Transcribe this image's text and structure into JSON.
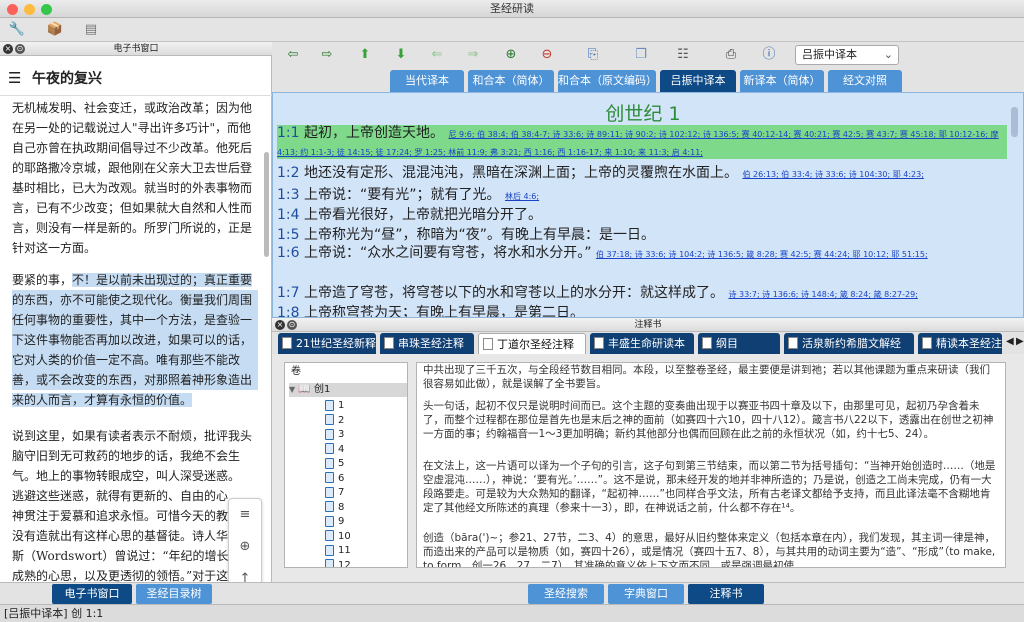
{
  "window": {
    "title": "圣经研读"
  },
  "left_panel": {
    "header": "电子书窗口",
    "article_title": "午夜的复兴",
    "paragraphs": [
      "无机械发明、社会变迁，或政治改革；因为他",
      "在另一处的记载说过人\"寻出许多巧计\"，而他",
      "自己亦曾在执政期间倡导过不少改革。他死后",
      "的耶路撒冷京城，跟他刚在父亲大卫去世后登",
      "基时相比，已大为改观。就当时的外表事物而",
      "言，已有不少改变；但如果就大自然和人性而",
      "言，则没有一样是新的。所罗门所说的，正是",
      "针对这一方面。"
    ],
    "p2_plain": "要紧的事，",
    "p2_hl": [
      "不！是以前未出现过的；真正重要",
      "的东西，亦不可能使之现代化。衡量我们周围",
      "任何事物的重要性，其中一个方法，是查验一",
      "下这件事物能否再加以改进，如果可以的话，",
      "它对人类的价值一定不高。唯有那些不能改",
      "善，或不会改变的东西，对那照着神形象造出",
      "来的人而言，才算有永恒的价值。"
    ],
    "p3": [
      "说到这里，如果有读者表示不耐烦，批评我头",
      "脑守旧到无可救药的地步的话，我绝不会生",
      "气。地上的事物转眼成空，叫人深受迷惑。",
      "逃避这些迷惑，就得有更新的、自由的心",
      "神贯注于爱慕和追求永恒。可惜今天的教",
      "没有造就出有这样心思的基督徒。诗人华",
      "斯（Wordswort）曾说过：“年纪的增长会",
      "成熟的心思，以及更透彻的领悟。”对于这句"
    ]
  },
  "left_tabs": [
    "电子书窗口",
    "圣经目录树"
  ],
  "status": "[吕振中译本] 创 1:1",
  "version_select": "吕振中译本",
  "version_tabs": [
    "当代译本",
    "和合本（简体）",
    "和合本（原文编码）",
    "吕振中译本",
    "新译本（简体）",
    "经文对照"
  ],
  "active_version_tab": 3,
  "chapter": "创世纪 1",
  "verses": [
    {
      "num": "1:1",
      "text": "起初，上帝创造天地。",
      "refs": "尼 9:6; 伯 38:4; 伯 38:4-7; 诗 33:6; 诗 89:11; 诗 90:2; 诗 102:12; 诗 136:5; 赛 40:12-14; 赛 40:21; 赛 42:5; 赛 43:7; 赛 45:18; 耶 10:12-16; 摩 4:13; 约 1:1-3; 徒 14:15; 徒 17:24; 罗 1:25; 林前 11:9; 弗 3:21; 西 1:16; 西 1:16-17; 来 1:10; 来 11:3; 启 4:11;"
    },
    {
      "num": "1:2",
      "text": "地还没有定形、混混沌沌，黑暗在深渊上面；上帝的灵覆煦在水面上。",
      "refs": "伯 26:13; 伯 33:4; 诗 33:6; 诗 104:30; 耶 4:23;"
    },
    {
      "num": "1:3",
      "text": "上帝说：“要有光”；就有了光。",
      "refs": "林后 4:6;"
    },
    {
      "num": "1:4",
      "text": "上帝看光很好，上帝就把光暗分开了。",
      "refs": ""
    },
    {
      "num": "1:5",
      "text": "上帝称光为“昼”，称暗为“夜”。有晚上有早晨：是一日。",
      "refs": ""
    },
    {
      "num": "1:6",
      "text": "上帝说：“众水之间要有穹苍，将水和水分开。”",
      "refs": "伯 37:18; 诗 33:6; 诗 104:2; 诗 136:5; 箴 8:28; 赛 42:5; 赛 44:24; 耶 10:12; 耶 51:15;"
    },
    {
      "num": "1:7",
      "text": "上帝造了穹苍，将穹苍以下的水和穹苍以上的水分开：就这样成了。",
      "refs": "诗 33:7; 诗 136:6; 诗 148:4; 箴 8:24; 箴 8:27-29;"
    },
    {
      "num": "1:8",
      "text": "上帝称穹苍为天；有晚上有早晨，是第二日。",
      "refs": ""
    }
  ],
  "commentary": {
    "header": "注释书",
    "tabs": [
      "21世纪圣经新释",
      "串珠圣经注释",
      "丁道尔圣经注释",
      "丰盛生命研读本",
      "纲目",
      "活泉新约希腊文解经",
      "精读本圣经注"
    ],
    "active_tab": 2,
    "tree_header": "卷",
    "tree_book": "创1",
    "tree_items": [
      "1",
      "2",
      "3",
      "4",
      "5",
      "6",
      "7",
      "8",
      "9",
      "10",
      "11",
      "12"
    ],
    "text": [
      "中共出现了三千五次，与全段经节数目相同。本段，以至整卷圣经，最主要便是讲到祂；若以其他课题为重点来研读（我们很容易如此做），就是误解了全书要旨。",
      "头一句话，起初不仅只是说明时间而已。这个主题的变奏曲出现于以赛亚书四十章及以下，由那里可见，起初乃孕含着未了，而整个过程都在那位是首先也是末后之神的面前（如赛四十六10，四十八12）。箴言书八22以下，透露出在创世之初神一方面的事；约翰福音一1～3更加明确；新约其他部分也偶而回顾在此之前的永恒状况（如，约十七5、24）。",
      "在文法上，这一片语可以译为一个子句的引言，这子句到第三节结束，而以第二节为括号插句：“当神开始创造时……（地是空虚混沌……），神说：‘要有光。’……”。这不是说，那未经开发的地并非神所造的；乃是说，创造之工尚未完成，仍有一大段路要走。可是较为大众熟知的翻译，“起初神……”也同样合乎文法，所有古老译文都给予支持，而且此译法毫不含糊地肯定了其他经文所陈述的真理（参来十一3），即，在神说话之前，什么都不存在¹⁴。",
      "创造（bāra(')~；参21、27节，二3、4）的意思，最好从旧约整体来定义（包括本章在内），我们发现，其主词一律是神，而造出来的产品可以是物质（如，赛四十26），或是情况（赛四十五7、8），与其共用的动词主要为“造”、“形成”（to make, to form，创一26、27，二7）。其准确的意义依上下文而不同，或是强调最初使"
    ]
  },
  "bottom_tabs": [
    "圣经搜索",
    "字典窗口",
    "注释书"
  ],
  "active_bottom_tab": 2,
  "colors": {
    "active_tab": "#0e4a86",
    "tab": "#4f93d7",
    "chapter_title": "#2e8b3a",
    "verse_highlight": "#7ed98b",
    "pane_bg": "#d2e4f8"
  }
}
